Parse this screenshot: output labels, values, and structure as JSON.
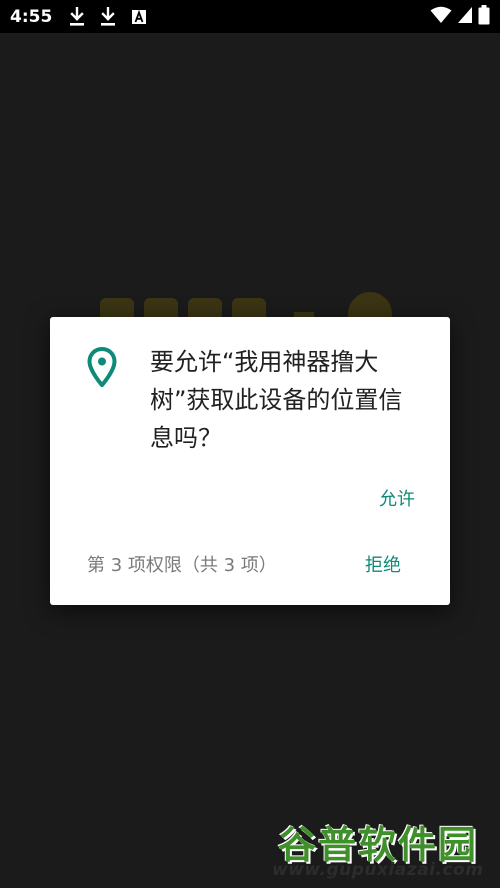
{
  "status_bar": {
    "time": "4:55",
    "left_icons": [
      "download-icon",
      "download-icon",
      "a-box-icon"
    ],
    "right_icons": [
      "wifi-icon",
      "signal-icon",
      "battery-icon"
    ]
  },
  "dialog": {
    "message": "要允许“我用神器撸大树”获取此设备的位置信息吗？",
    "allow_label": "允许",
    "deny_label": "拒绝",
    "permission_counter": "第 3 项权限（共 3 项）",
    "icon": "location-pin-icon",
    "accent_color": "#0f8a78"
  },
  "watermark": {
    "title": "谷普软件园",
    "url": "www.gupuxiazai.com"
  }
}
